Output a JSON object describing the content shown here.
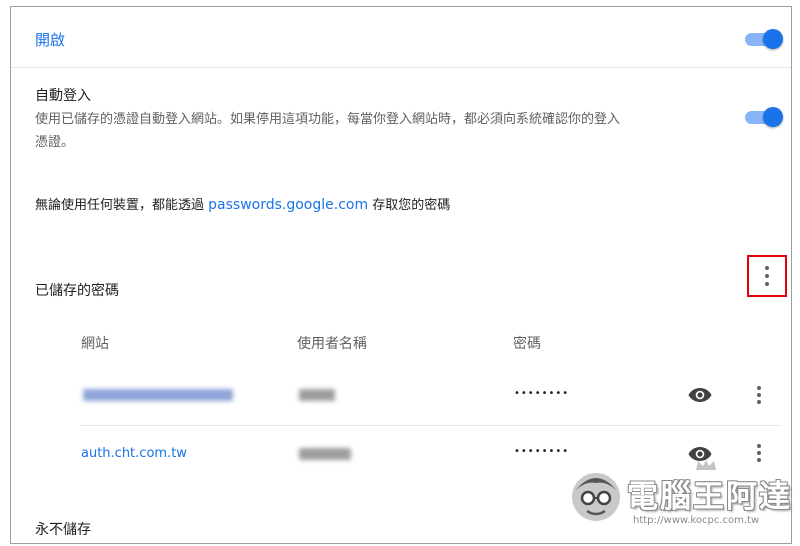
{
  "header": {
    "title": "開啟"
  },
  "auto_signin": {
    "title": "自動登入",
    "description_line1": "使用已儲存的憑證自動登入網站。如果停用這項功能，每當你登入網站時，都必須向系統確認你的登入",
    "description_line2": "憑證。"
  },
  "info": {
    "prefix": "無論使用任何裝置，都能透過 ",
    "link": "passwords.google.com",
    "suffix": " 存取您的密碼"
  },
  "saved": {
    "title": "已儲存的密碼",
    "columns": {
      "site": "網站",
      "username": "使用者名稱",
      "password": "密碼"
    },
    "rows": [
      {
        "site": "",
        "username": "",
        "password": "••••••••"
      },
      {
        "site": "auth.cht.com.tw",
        "username": "",
        "password": "••••••••"
      }
    ]
  },
  "never_saved": {
    "title": "永不儲存"
  },
  "watermark": {
    "brand": "電腦王阿達",
    "url": "http://www.kocpc.com.tw"
  },
  "colors": {
    "accent": "#1a73e8",
    "highlight_box": "#e0000b"
  },
  "icons": [
    "toggle-switch",
    "more-vert-icon",
    "eye-icon"
  ]
}
